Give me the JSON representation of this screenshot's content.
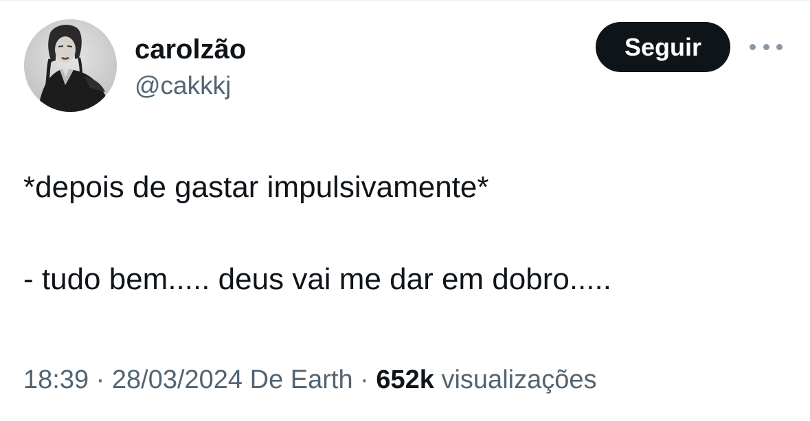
{
  "author": {
    "display_name": "carolzão",
    "handle": "@cakkkj",
    "avatar_icon": "user-avatar-photo"
  },
  "actions": {
    "follow_label": "Seguir",
    "more_icon": "more-horizontal-icon"
  },
  "tweet": {
    "lines": [
      "*depois de gastar impulsivamente*",
      "- tudo bem..... deus vai me dar em dobro....."
    ]
  },
  "meta": {
    "time": "18:39",
    "separator": "·",
    "date": "28/03/2024",
    "source": "De Earth",
    "views_count": "652k",
    "views_label": "visualizações"
  },
  "colors": {
    "text_primary": "#0f1419",
    "text_secondary": "#536471",
    "button_bg": "#0f1419",
    "button_text": "#ffffff"
  }
}
